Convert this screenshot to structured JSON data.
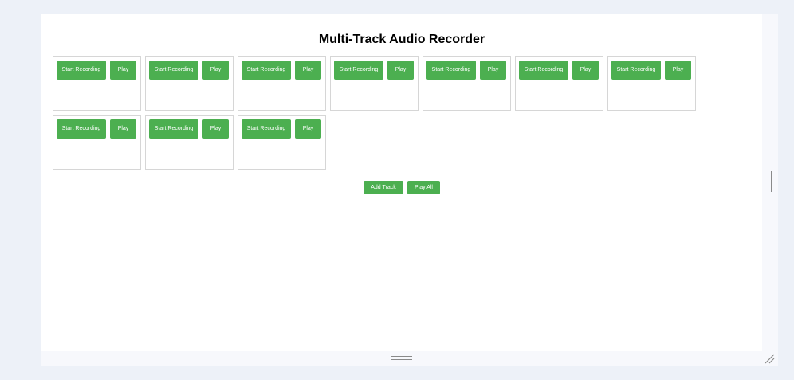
{
  "app": {
    "title": "Multi-Track Audio Recorder"
  },
  "tracks": [
    {
      "record_label": "Start Recording",
      "play_label": "Play"
    },
    {
      "record_label": "Start Recording",
      "play_label": "Play"
    },
    {
      "record_label": "Start Recording",
      "play_label": "Play"
    },
    {
      "record_label": "Start Recording",
      "play_label": "Play"
    },
    {
      "record_label": "Start Recording",
      "play_label": "Play"
    },
    {
      "record_label": "Start Recording",
      "play_label": "Play"
    },
    {
      "record_label": "Start Recording",
      "play_label": "Play"
    },
    {
      "record_label": "Start Recording",
      "play_label": "Play"
    },
    {
      "record_label": "Start Recording",
      "play_label": "Play"
    },
    {
      "record_label": "Start Recording",
      "play_label": "Play"
    }
  ],
  "controls": {
    "add_track_label": "Add Track",
    "play_all_label": "Play All"
  },
  "colors": {
    "accent": "#4caf50",
    "page_background": "#ffffff",
    "outer_background": "#edf1f8",
    "track_border": "#d6d6d6"
  },
  "icons": {
    "vertical_grip": "vertical-resize-grip-icon",
    "horizontal_grip": "horizontal-resize-grip-icon",
    "corner_grip": "corner-resize-grip-icon"
  }
}
